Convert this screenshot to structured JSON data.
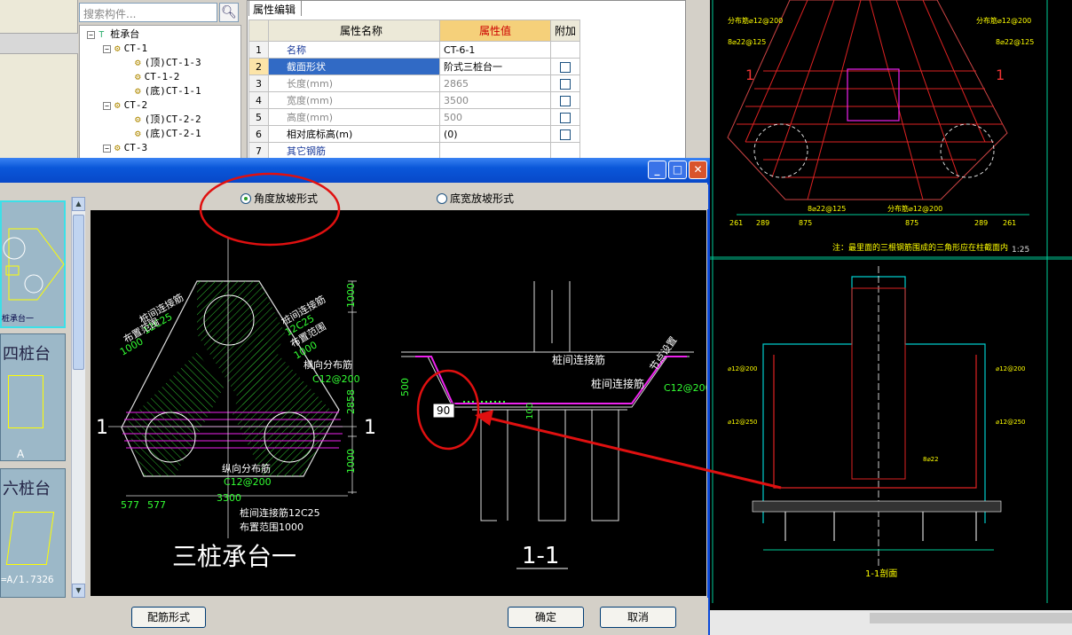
{
  "search": {
    "placeholder": "搜索构件..."
  },
  "tree": {
    "root": "桩承台",
    "items": [
      {
        "label": "CT-1",
        "level": 1
      },
      {
        "label": "(顶)CT-1-3",
        "level": 2
      },
      {
        "label": "CT-1-2",
        "level": 2
      },
      {
        "label": "(底)CT-1-1",
        "level": 2
      },
      {
        "label": "CT-2",
        "level": 1
      },
      {
        "label": "(顶)CT-2-2",
        "level": 2
      },
      {
        "label": "(底)CT-2-1",
        "level": 2
      },
      {
        "label": "CT-3",
        "level": 1
      }
    ]
  },
  "props": {
    "tab": "属性编辑",
    "headers": {
      "name": "属性名称",
      "value": "属性值",
      "add": "附加"
    },
    "rows": [
      {
        "n": "1",
        "name": "名称",
        "value": "CT-6-1"
      },
      {
        "n": "2",
        "name": "截面形状",
        "value": "阶式三桩台一"
      },
      {
        "n": "3",
        "name": "长度(mm)",
        "value": "2865"
      },
      {
        "n": "4",
        "name": "宽度(mm)",
        "value": "3500"
      },
      {
        "n": "5",
        "name": "高度(mm)",
        "value": "500"
      },
      {
        "n": "6",
        "name": "相对底标高(m)",
        "value": "(0)"
      },
      {
        "n": "7",
        "name": "其它钢筋",
        "value": ""
      }
    ]
  },
  "dialog": {
    "radio_angle": "角度放坡形式",
    "radio_width": "底宽放坡形式",
    "btn_rebar": "配筋形式",
    "btn_ok": "确定",
    "btn_cancel": "取消"
  },
  "thumbs": {
    "t2": "四桩台",
    "t3": "六桩台",
    "t1label": "桩承台一",
    "t2sub": "A",
    "t3sub": "=A/1.7326"
  },
  "drawing": {
    "title_plan": "三桩承台一",
    "title_section": "1-1",
    "section_mark": "1",
    "l_pile_link": "桩间连接筋",
    "l_12c25": "12C25",
    "l_range": "布置范围",
    "l_1000": "1000",
    "l_trans": "横向分布筋",
    "l_c12200": "C12@200",
    "l_long": "纵向分布筋",
    "l_pile_link2": "桩间连接筋12C25",
    "l_range2": "布置范围1000",
    "d_1000a": "1000",
    "d_2858": "2858",
    "d_1000b": "1000",
    "d_577a": "577",
    "d_577b": "577",
    "d_3300": "3300",
    "s_500": "500",
    "s_100": "100",
    "s_90": "90",
    "s_node": "节点设置",
    "s_c12": "C12@200"
  },
  "cad": {
    "t1": "注：最里面的三根钢筋围成的三角形应在柱截面内",
    "scale": "1:25",
    "sec": "1-1剖面",
    "dims": [
      "261",
      "289",
      "875",
      "875",
      "289",
      "261"
    ]
  }
}
